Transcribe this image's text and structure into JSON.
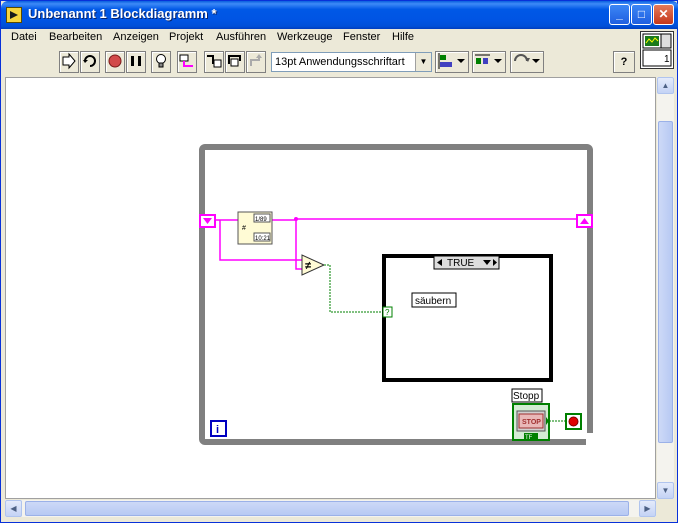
{
  "window": {
    "title": "Unbenannt 1 Blockdiagramm *"
  },
  "title_buttons": {
    "minimize_glyph": "_",
    "maximize_glyph": "□",
    "close_glyph": "✕"
  },
  "menu": {
    "items": [
      {
        "label": "Datei"
      },
      {
        "label": "Bearbeiten"
      },
      {
        "label": "Anzeigen"
      },
      {
        "label": "Projekt"
      },
      {
        "label": "Ausführen"
      },
      {
        "label": "Werkzeuge"
      },
      {
        "label": "Fenster"
      },
      {
        "label": "Hilfe"
      }
    ]
  },
  "toolbar": {
    "font_select_value": "13pt Anwendungsschriftart",
    "help_glyph": "?"
  },
  "connector_pane": {
    "number": "1"
  },
  "diagram": {
    "case_selector_value": "TRUE",
    "case_label": "säubern",
    "stop_label": "Stopp",
    "stop_button_text": "STOP",
    "tf_text": "TF",
    "iteration_glyph": "i",
    "not_equal_glyph": "≠",
    "timer_lines": [
      "1/89",
      "#",
      "10:21"
    ]
  },
  "colors": {
    "wire_pink": "#ff00ff",
    "wire_green": "#008000",
    "loop_border": "#808080",
    "bool_terminal": "#008000"
  }
}
